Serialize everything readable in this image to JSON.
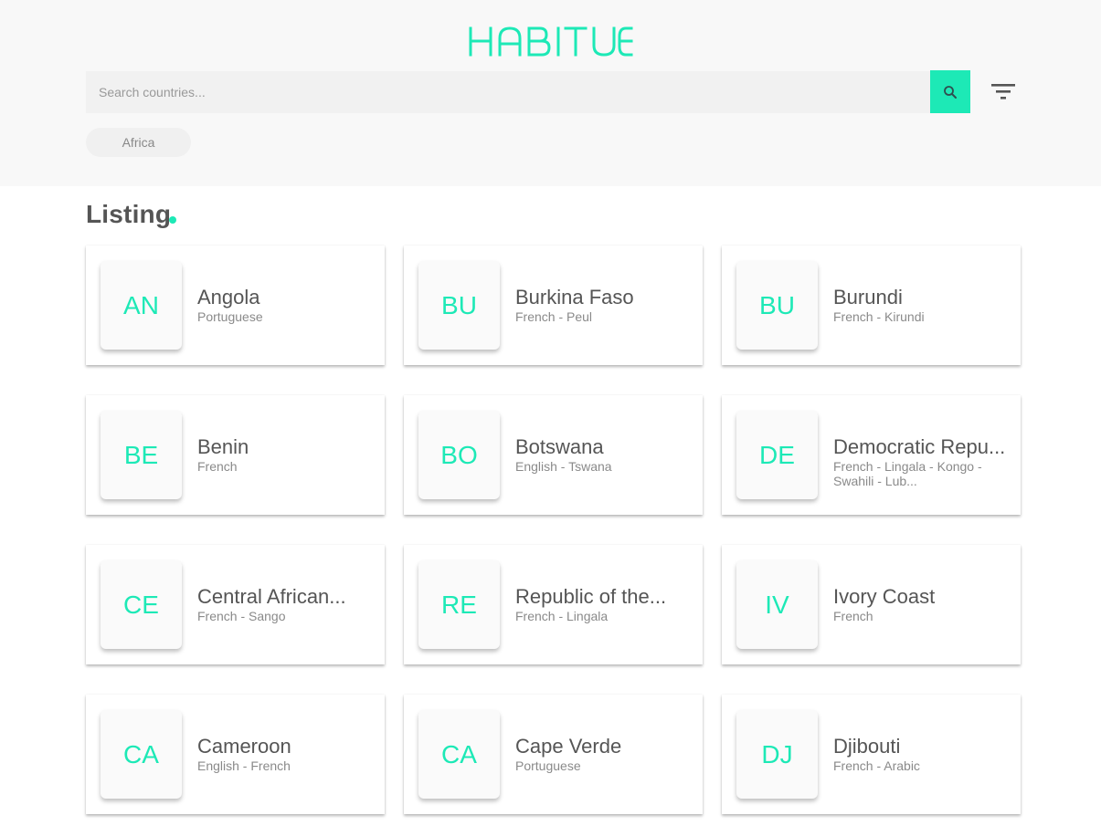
{
  "header": {
    "logo_text": "HABITUE",
    "search": {
      "placeholder": "Search countries...",
      "value": ""
    },
    "search_icon": "search-icon",
    "filter_icon": "filter-icon",
    "active_filter": "Africa",
    "accent_color": "#1de9b6"
  },
  "listing": {
    "title": "Listing",
    "countries": [
      {
        "code": "AN",
        "name": "Angola",
        "languages": "Portuguese"
      },
      {
        "code": "BU",
        "name": "Burkina Faso",
        "languages": "French - Peul"
      },
      {
        "code": "BU",
        "name": "Burundi",
        "languages": "French - Kirundi"
      },
      {
        "code": "BE",
        "name": "Benin",
        "languages": "French"
      },
      {
        "code": "BO",
        "name": "Botswana",
        "languages": "English - Tswana"
      },
      {
        "code": "DE",
        "name": "Democratic Repu...",
        "languages": "French - Lingala - Kongo - Swahili - Lub..."
      },
      {
        "code": "CE",
        "name": "Central African...",
        "languages": "French - Sango"
      },
      {
        "code": "RE",
        "name": "Republic of the...",
        "languages": "French - Lingala"
      },
      {
        "code": "IV",
        "name": "Ivory Coast",
        "languages": "French"
      },
      {
        "code": "CA",
        "name": "Cameroon",
        "languages": "English - French"
      },
      {
        "code": "CA",
        "name": "Cape Verde",
        "languages": "Portuguese"
      },
      {
        "code": "DJ",
        "name": "Djibouti",
        "languages": "French - Arabic"
      }
    ]
  }
}
